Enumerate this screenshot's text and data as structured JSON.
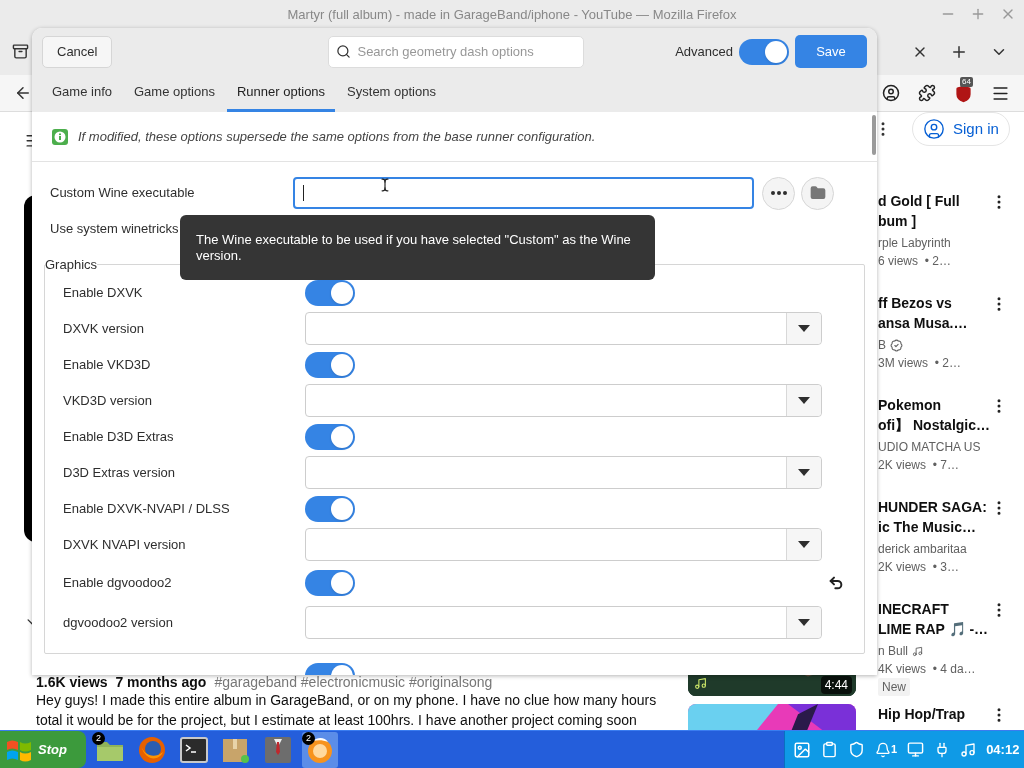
{
  "browser": {
    "title": "Martyr (full album) - made in GarageBand/iphone - YouTube — Mozilla Firefox",
    "extension_badge": "64"
  },
  "youtube": {
    "sign_in": "Sign in",
    "stats": "1.6K views  7 months ago",
    "hashtags": "#garageband #electronicmusic #originalsong",
    "description": [
      "Hey guys! I made this entire album in GarageBand, or on my phone. I have no clue how many hours",
      "total it would be for the project, but I estimate at least 100hrs. I have another project coming soon"
    ],
    "recommendations": [
      {
        "kind": "covered",
        "title": [
          "d Gold [ Full",
          "bum ]"
        ],
        "channel": "rple Labyrinth",
        "verified": false,
        "music": false,
        "meta": "6 views  • 2…"
      },
      {
        "kind": "covered",
        "title": [
          "ff Bezos vs",
          "ansa Musa.…"
        ],
        "channel": "B",
        "verified": true,
        "music": false,
        "meta": "3M views  • 2…"
      },
      {
        "kind": "covered",
        "title": [
          "Pokemon",
          "ofi】 Nostalgic…"
        ],
        "channel": "UDIO MATCHA US",
        "verified": false,
        "music": false,
        "meta": "2K views  • 7…"
      },
      {
        "kind": "covered",
        "title": [
          "HUNDER SAGA:",
          "ic The Music…"
        ],
        "channel": "derick ambaritaa",
        "verified": false,
        "music": false,
        "meta": "2K views  • 3…"
      },
      {
        "kind": "visible",
        "title": [
          "INECRAFT",
          "LIME RAP 🎵 -…"
        ],
        "channel": "n Bull",
        "verified": false,
        "music": true,
        "meta": "4K views  • 4 da…",
        "badge": "New",
        "duration": "4:44"
      },
      {
        "kind": "visible",
        "title": [
          "Hip Hop/Trap"
        ]
      }
    ]
  },
  "dialog": {
    "cancel": "Cancel",
    "search_placeholder": "Search geometry dash options",
    "advanced_label": "Advanced",
    "advanced_on": true,
    "save": "Save",
    "tabs": [
      {
        "label": "Game info",
        "selected": false
      },
      {
        "label": "Game options",
        "selected": false
      },
      {
        "label": "Runner options",
        "selected": true
      },
      {
        "label": "System options",
        "selected": false
      }
    ],
    "notice": "If modified, these options supersede the same options from the base runner configuration.",
    "rows": [
      {
        "kind": "file",
        "label": "Custom Wine executable",
        "focused": true
      },
      {
        "kind": "label",
        "label": "Use system winetricks"
      }
    ],
    "groups": [
      {
        "title": "Graphics",
        "rows": [
          {
            "kind": "toggle",
            "label": "Enable DXVK",
            "on": true,
            "modified": false
          },
          {
            "kind": "select",
            "label": "DXVK version",
            "modified": false
          },
          {
            "kind": "toggle",
            "label": "Enable VKD3D",
            "on": true,
            "modified": false
          },
          {
            "kind": "select",
            "label": "VKD3D version",
            "modified": false
          },
          {
            "kind": "toggle",
            "label": "Enable D3D Extras",
            "on": true,
            "modified": false
          },
          {
            "kind": "select",
            "label": "D3D Extras version",
            "modified": false
          },
          {
            "kind": "toggle",
            "label": "Enable DXVK-NVAPI / DLSS",
            "on": true,
            "modified": false
          },
          {
            "kind": "select",
            "label": "DXVK NVAPI version",
            "modified": false
          },
          {
            "kind": "toggle",
            "label": "Enable dgvoodoo2",
            "on": true,
            "modified": true
          },
          {
            "kind": "select",
            "label": "dgvoodoo2 version",
            "modified": false
          }
        ]
      }
    ],
    "next_row": {
      "kind": "toggle",
      "on": true
    },
    "tooltip": "The Wine executable to be used if you have selected \"Custom\" as the Wine version."
  },
  "taskbar": {
    "start": "Stop",
    "apps": [
      {
        "kind": "folder",
        "badge": "2",
        "active": false
      },
      {
        "kind": "firefox",
        "active": false
      },
      {
        "kind": "terminal",
        "active": false
      },
      {
        "kind": "package",
        "active": false
      },
      {
        "kind": "suit",
        "active": false
      },
      {
        "kind": "orange",
        "badge": "2",
        "active": true
      }
    ],
    "notification_count": "1",
    "clock": "04:12"
  }
}
